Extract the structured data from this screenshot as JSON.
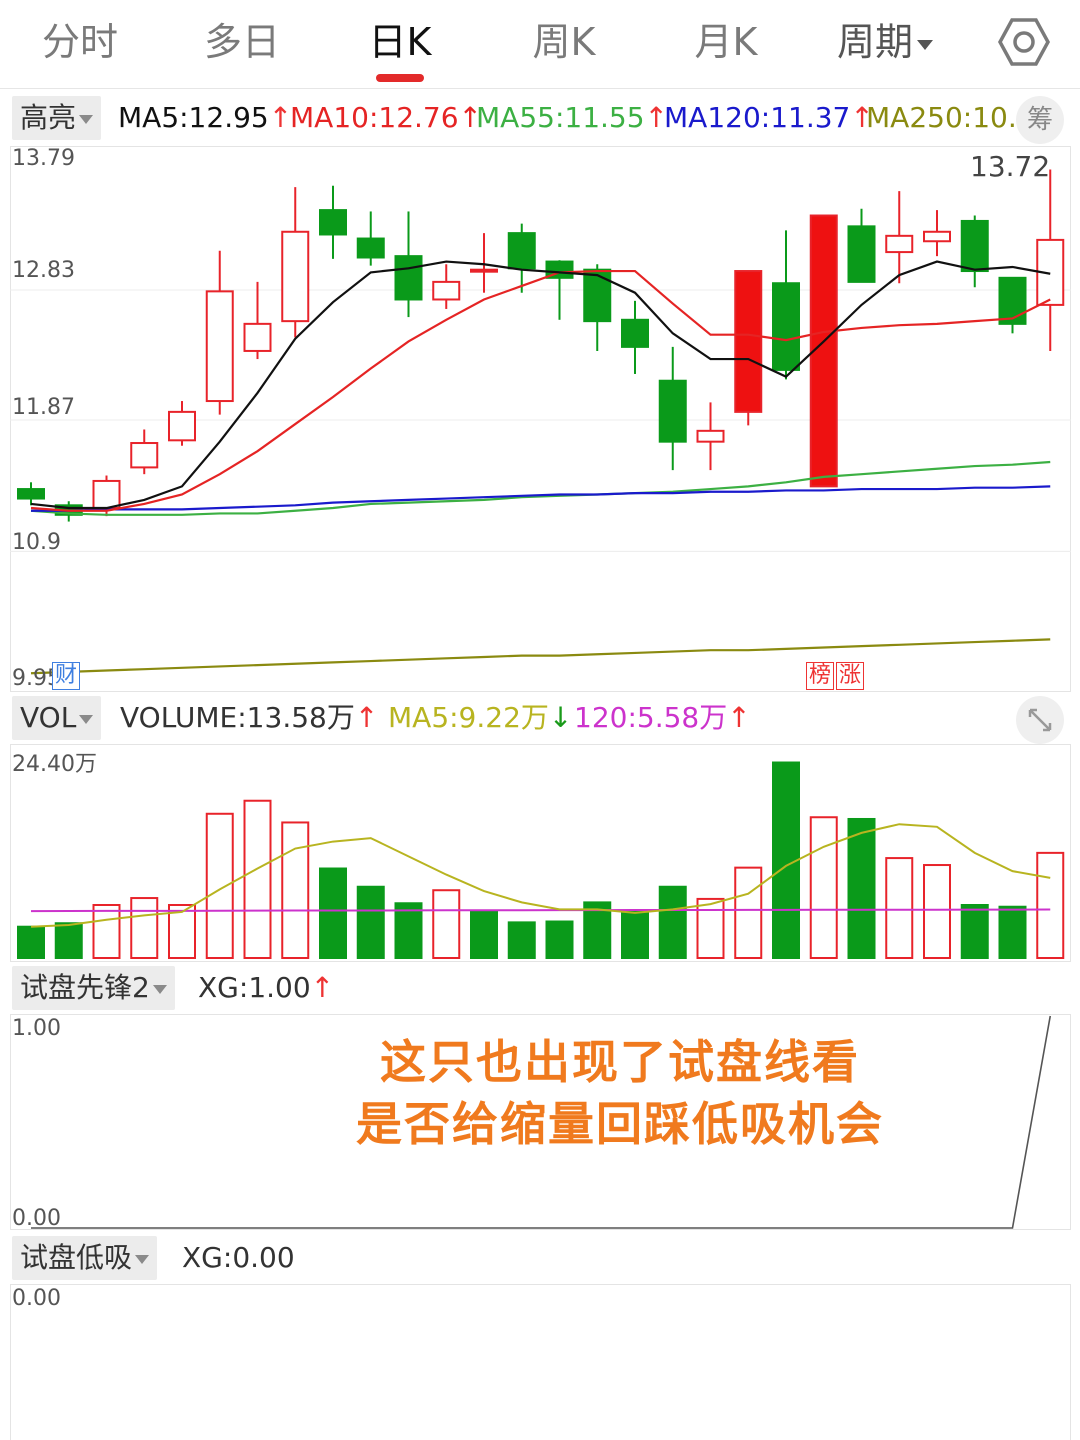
{
  "tabs": {
    "items": [
      "分时",
      "多日",
      "日K",
      "周K",
      "月K",
      "周期"
    ],
    "active_index": 2
  },
  "main_legend": {
    "mode": "高亮",
    "ma5": "MA5:12.95",
    "ma10": "MA10:12.76",
    "ma55": "MA55:11.55",
    "ma120": "MA120:11.37",
    "ma250": "MA250:10.",
    "chip_button": "筹",
    "colors": {
      "ma5": "#111111",
      "ma10": "#e52424",
      "ma55": "#3cb043",
      "ma120": "#1a1acc",
      "ma250": "#8a8a10"
    }
  },
  "vol_legend": {
    "mode": "VOL",
    "volume": "VOLUME:13.58万",
    "ma5": "MA5:9.22万",
    "ma120": "120:5.58万",
    "colors": {
      "volume": "#333333",
      "ma5": "#b8b420",
      "ma120": "#cc33cc"
    }
  },
  "xg1_legend": {
    "mode": "试盘先锋2",
    "value": "XG:1.00"
  },
  "xg2_legend": {
    "mode": "试盘低吸",
    "value": "XG:0.00"
  },
  "annotation": {
    "line1": "这只也出现了试盘线看",
    "line2": "是否给缩量回踩低吸机会"
  },
  "tags": {
    "cai": "财",
    "bang": "榜",
    "zhang": "涨"
  },
  "chart_data": [
    {
      "type": "candlestick",
      "y_ticks": [
        "13.79",
        "12.83",
        "11.87",
        "10.9",
        "9.95"
      ],
      "ylim": [
        9.95,
        13.79
      ],
      "max_label": "13.72",
      "candles": [
        {
          "o": 11.36,
          "c": 11.29,
          "h": 11.41,
          "l": 11.24
        },
        {
          "o": 11.24,
          "c": 11.17,
          "h": 11.27,
          "l": 11.12
        },
        {
          "o": 11.22,
          "c": 11.42,
          "h": 11.46,
          "l": 11.16
        },
        {
          "o": 11.52,
          "c": 11.7,
          "h": 11.8,
          "l": 11.47
        },
        {
          "o": 11.72,
          "c": 11.93,
          "h": 12.01,
          "l": 11.68
        },
        {
          "o": 12.01,
          "c": 12.82,
          "h": 13.12,
          "l": 11.91
        },
        {
          "o": 12.38,
          "c": 12.58,
          "h": 12.89,
          "l": 12.32
        },
        {
          "o": 12.6,
          "c": 13.26,
          "h": 13.59,
          "l": 12.48
        },
        {
          "o": 13.42,
          "c": 13.24,
          "h": 13.6,
          "l": 13.06
        },
        {
          "o": 13.21,
          "c": 13.07,
          "h": 13.41,
          "l": 13.01
        },
        {
          "o": 13.08,
          "c": 12.76,
          "h": 13.41,
          "l": 12.63
        },
        {
          "o": 12.76,
          "c": 12.89,
          "h": 13.02,
          "l": 12.69
        },
        {
          "o": 12.98,
          "c": 12.98,
          "h": 13.25,
          "l": 12.81
        },
        {
          "o": 13.25,
          "c": 12.99,
          "h": 13.32,
          "l": 12.81
        },
        {
          "o": 13.04,
          "c": 12.92,
          "h": 13.05,
          "l": 12.61
        },
        {
          "o": 12.98,
          "c": 12.6,
          "h": 13.02,
          "l": 12.38
        },
        {
          "o": 12.61,
          "c": 12.41,
          "h": 12.75,
          "l": 12.21
        },
        {
          "o": 12.16,
          "c": 11.71,
          "h": 12.41,
          "l": 11.5
        },
        {
          "o": 11.71,
          "c": 11.79,
          "h": 12.0,
          "l": 11.5
        },
        {
          "o": 11.93,
          "c": 12.97,
          "h": 12.97,
          "l": 11.83
        },
        {
          "o": 12.88,
          "c": 12.24,
          "h": 13.27,
          "l": 12.17
        },
        {
          "o": 11.38,
          "c": 13.38,
          "h": 13.38,
          "l": 11.38
        },
        {
          "o": 13.3,
          "c": 12.89,
          "h": 13.43,
          "l": 12.89
        },
        {
          "o": 13.11,
          "c": 13.23,
          "h": 13.56,
          "l": 12.88
        },
        {
          "o": 13.19,
          "c": 13.26,
          "h": 13.42,
          "l": 13.08
        },
        {
          "o": 13.34,
          "c": 12.97,
          "h": 13.38,
          "l": 12.85
        },
        {
          "o": 12.92,
          "c": 12.58,
          "h": 12.92,
          "l": 12.51
        },
        {
          "o": 12.72,
          "c": 13.2,
          "h": 13.72,
          "l": 12.38
        }
      ],
      "ma5": [
        11.25,
        11.22,
        11.22,
        11.28,
        11.38,
        11.71,
        12.07,
        12.47,
        12.74,
        12.96,
        12.99,
        13.04,
        13.02,
        12.98,
        12.96,
        12.94,
        12.81,
        12.51,
        12.32,
        12.32,
        12.19,
        12.45,
        12.72,
        12.94,
        13.04,
        12.98,
        13.0,
        12.95
      ],
      "ma10": [
        11.22,
        11.2,
        11.2,
        11.25,
        11.32,
        11.47,
        11.64,
        11.84,
        12.04,
        12.25,
        12.45,
        12.61,
        12.76,
        12.86,
        12.96,
        12.97,
        12.97,
        12.73,
        12.5,
        12.5,
        12.46,
        12.52,
        12.55,
        12.57,
        12.58,
        12.6,
        12.62,
        12.76
      ],
      "ma55": [
        11.2,
        11.18,
        11.17,
        11.17,
        11.17,
        11.18,
        11.18,
        11.2,
        11.22,
        11.25,
        11.26,
        11.27,
        11.28,
        11.3,
        11.31,
        11.32,
        11.33,
        11.34,
        11.36,
        11.38,
        11.41,
        11.45,
        11.47,
        11.49,
        11.51,
        11.53,
        11.54,
        11.56
      ],
      "ma120": [
        11.2,
        11.2,
        11.21,
        11.21,
        11.21,
        11.22,
        11.23,
        11.24,
        11.26,
        11.27,
        11.28,
        11.29,
        11.3,
        11.31,
        11.32,
        11.32,
        11.33,
        11.33,
        11.34,
        11.34,
        11.35,
        11.35,
        11.36,
        11.36,
        11.36,
        11.37,
        11.37,
        11.38
      ],
      "ma250": [
        10.0,
        10.01,
        10.02,
        10.03,
        10.04,
        10.05,
        10.06,
        10.07,
        10.08,
        10.09,
        10.1,
        10.11,
        10.12,
        10.13,
        10.13,
        10.14,
        10.15,
        10.16,
        10.17,
        10.17,
        10.18,
        10.19,
        10.2,
        10.21,
        10.22,
        10.23,
        10.24,
        10.25
      ]
    },
    {
      "type": "bar",
      "y_top_label": "24.40万",
      "ylim": [
        0,
        24.4
      ],
      "values": [
        3.6,
        4.0,
        6.1,
        6.9,
        6.1,
        16.6,
        18.1,
        15.6,
        10.3,
        8.2,
        6.3,
        7.8,
        5.4,
        4.1,
        4.2,
        6.4,
        5.3,
        8.2,
        6.8,
        10.4,
        22.5,
        16.2,
        16.0,
        11.5,
        10.7,
        6.1,
        5.9,
        12.1
      ],
      "up": [
        false,
        false,
        true,
        true,
        true,
        true,
        true,
        true,
        false,
        false,
        false,
        true,
        false,
        false,
        false,
        false,
        false,
        false,
        true,
        true,
        false,
        true,
        false,
        true,
        true,
        false,
        false,
        true
      ],
      "ma5": [
        3.6,
        3.8,
        4.4,
        4.9,
        5.3,
        7.9,
        10.3,
        12.6,
        13.4,
        13.8,
        11.7,
        9.6,
        7.7,
        6.4,
        5.6,
        5.6,
        5.2,
        5.6,
        6.2,
        7.4,
        10.6,
        12.8,
        14.4,
        15.4,
        15.1,
        12.1,
        10.0,
        9.22
      ],
      "ma120": [
        5.4,
        5.41,
        5.42,
        5.43,
        5.43,
        5.44,
        5.45,
        5.46,
        5.46,
        5.47,
        5.48,
        5.49,
        5.49,
        5.5,
        5.51,
        5.51,
        5.52,
        5.52,
        5.53,
        5.54,
        5.54,
        5.55,
        5.55,
        5.56,
        5.56,
        5.57,
        5.57,
        5.58
      ]
    },
    {
      "type": "line",
      "y_ticks": [
        "1.00",
        "0.00"
      ],
      "ylim": [
        0,
        1
      ],
      "values": [
        0,
        0,
        0,
        0,
        0,
        0,
        0,
        0,
        0,
        0,
        0,
        0,
        0,
        0,
        0,
        0,
        0,
        0,
        0,
        0,
        0,
        0,
        0,
        0,
        0,
        0,
        0,
        1
      ]
    },
    {
      "type": "line",
      "y_ticks": [
        "0.00"
      ],
      "ylim": [
        0,
        1
      ],
      "values": []
    }
  ]
}
